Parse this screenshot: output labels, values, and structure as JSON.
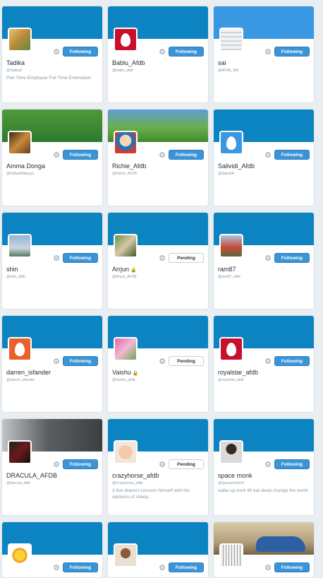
{
  "theme": {
    "accent": "#3a94d6",
    "banner": "#0b84c1"
  },
  "cards": [
    {
      "name": "Tadika",
      "handle": "@Tadika6",
      "bio": "Part Time Employee Full Time Entertainer",
      "button": "Following",
      "avatar": "photo-avatar"
    },
    {
      "name": "Bablu_Afdb",
      "handle": "@bablu_afdb",
      "bio": "",
      "button": "Following",
      "avatar": "egg-avatar-red"
    },
    {
      "name": "sai",
      "handle": "@AFDB_SAI",
      "bio": "",
      "button": "Following",
      "avatar": "screenshot-avatar"
    },
    {
      "name": "Amma Donga",
      "handle": "@KalluteMalayya",
      "bio": "",
      "button": "Following",
      "avatar": "photo-avatar"
    },
    {
      "name": "Richie_Afdb",
      "handle": "@Richie_AFDB",
      "bio": "",
      "button": "Following",
      "avatar": "cartoon-avatar"
    },
    {
      "name": "Salividi_Afdb",
      "handle": "@SalividA",
      "bio": "",
      "button": "Following",
      "avatar": "egg-avatar-blue"
    },
    {
      "name": "shin",
      "handle": "@shin_afdb",
      "bio": "",
      "button": "Following",
      "avatar": "landscape-avatar"
    },
    {
      "name": "Arrjun",
      "handle": "@Arrjun_AFDB",
      "bio": "",
      "button": "Pending",
      "avatar": "photo-avatar",
      "locked": true
    },
    {
      "name": "ram87",
      "handle": "@ram87_afdb",
      "bio": "",
      "button": "Following",
      "avatar": "landscape-avatar"
    },
    {
      "name": "darren_isfander",
      "handle": "@darren_isfander",
      "bio": "",
      "button": "Following",
      "avatar": "egg-avatar-orange"
    },
    {
      "name": "Vaishu",
      "handle": "@Vaishu_afdb",
      "bio": "",
      "button": "Pending",
      "avatar": "photo-avatar",
      "locked": true
    },
    {
      "name": "royalstar_afdb",
      "handle": "@royalstar_afdb",
      "bio": "",
      "button": "Following",
      "avatar": "egg-avatar-red"
    },
    {
      "name": "DRACULA_AFDB",
      "handle": "@dracula_afdb",
      "bio": "",
      "button": "Following",
      "avatar": "photo-avatar"
    },
    {
      "name": "crazyhorse_afdb",
      "handle": "@Crazyhorse_afdb",
      "bio": "A lion doesn't concern himself with the opinions of sheep..",
      "button": "Pending",
      "avatar": "cartoon-avatar"
    },
    {
      "name": "space monk",
      "handle": "@Spacemonk14",
      "bio": "wake up work lift eat sleep change the world",
      "button": "Following",
      "avatar": "photo-avatar"
    },
    {
      "name": "",
      "handle": "",
      "bio": "",
      "button": "Following",
      "avatar": "sun-avatar"
    },
    {
      "name": "",
      "handle": "",
      "bio": "",
      "button": "Following",
      "avatar": "photo-avatar"
    },
    {
      "name": "",
      "handle": "",
      "bio": "",
      "button": "Following",
      "avatar": "photo-avatar"
    }
  ]
}
